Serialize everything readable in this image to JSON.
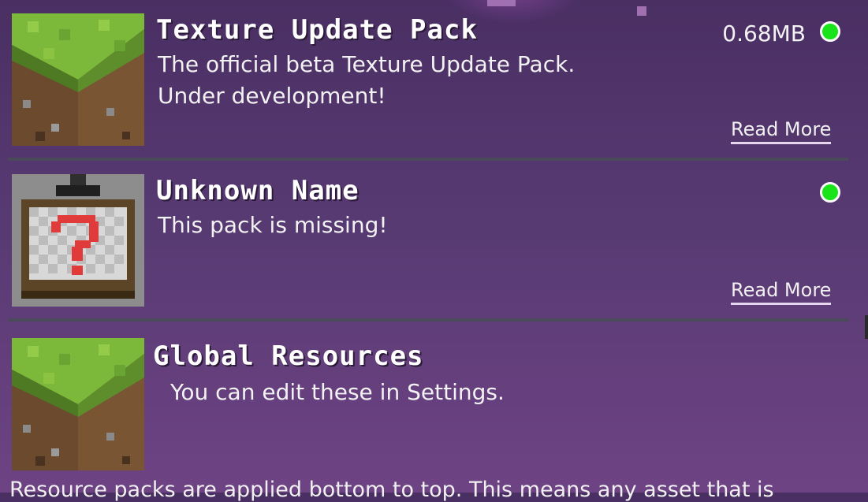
{
  "packs": [
    {
      "title": "Texture Update Pack",
      "description_line1": "The official beta Texture Update Pack.",
      "description_line2": "Under development!",
      "size": "0.68MB",
      "read_more": "Read More",
      "icon": "grass-block-icon",
      "status_color": "#19e319"
    },
    {
      "title": "Unknown Name",
      "description_line1": "This pack is missing!",
      "read_more": "Read More",
      "icon": "missing-pack-icon",
      "status_color": "#19e319"
    },
    {
      "title": "Global Resources",
      "description_line1": "You can edit these in Settings.",
      "icon": "grass-block-icon"
    }
  ],
  "footer_text": "Resource packs are applied bottom to top. This means any asset that is"
}
